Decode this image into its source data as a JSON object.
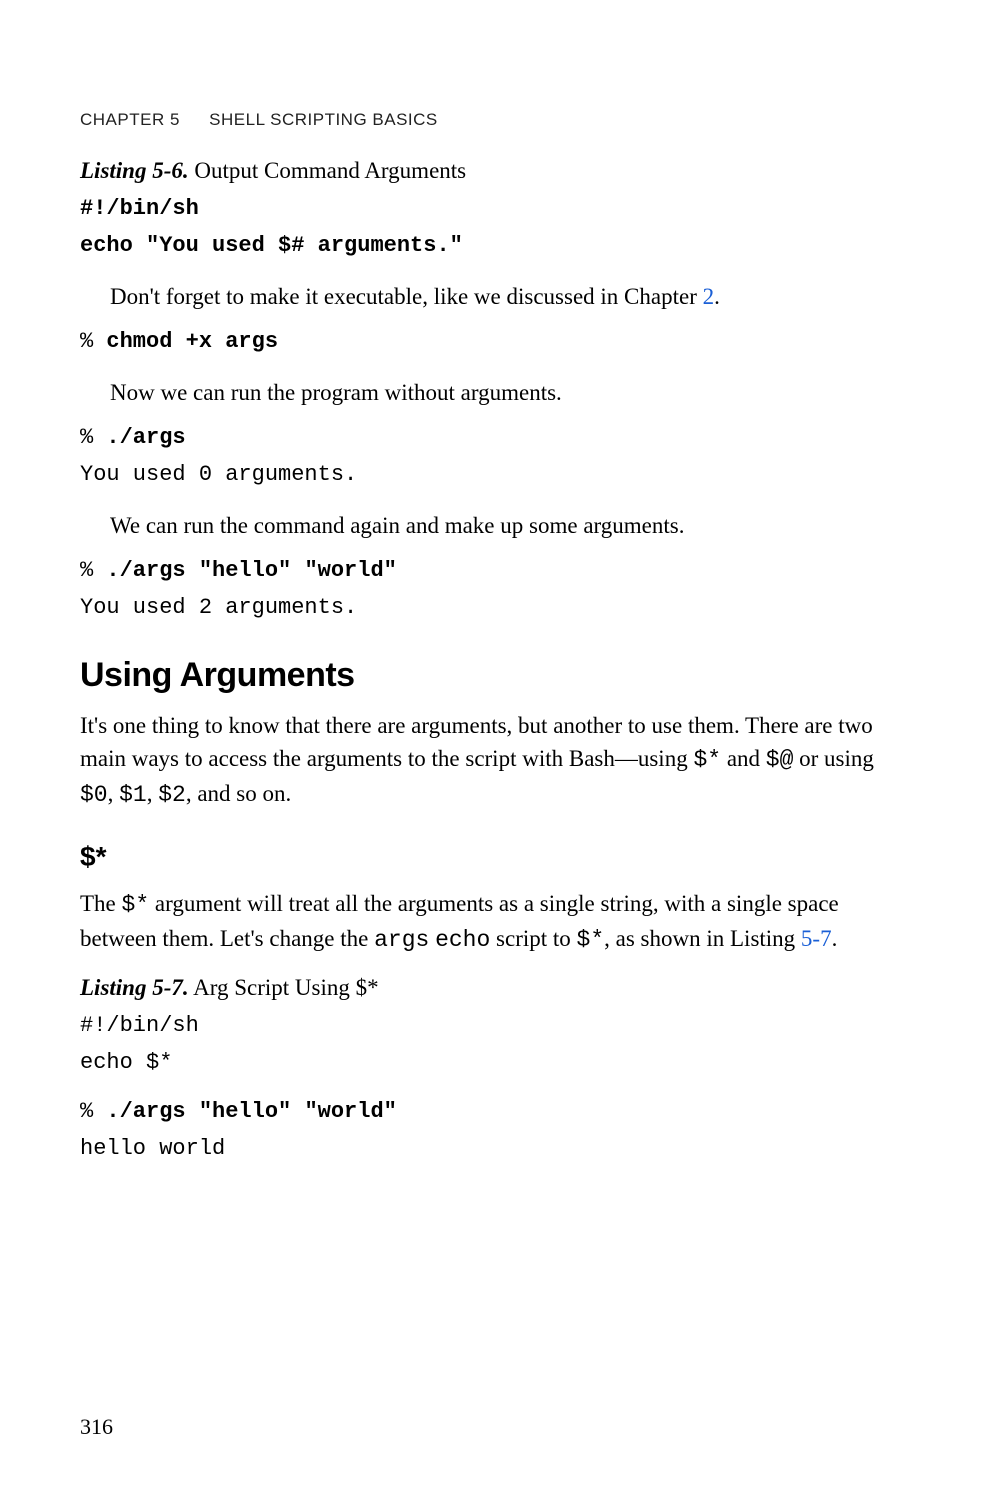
{
  "header": {
    "chapter": "CHAPTER 5",
    "title": "SHELL SCRIPTING BASICS"
  },
  "listing56": {
    "label": "Listing 5-6.",
    "title": " Output Command Arguments",
    "code_l1": "#!/bin/sh",
    "code_l2": "echo \"You used $# arguments.\""
  },
  "para1_a": "Don't forget to make it executable, like we discussed in Chapter ",
  "para1_link": "2",
  "para1_b": ".",
  "cmd1_prompt": "% ",
  "cmd1": "chmod +x args",
  "para2": "Now we can run the program without arguments.",
  "cmd2_prompt": "% ",
  "cmd2": "./args",
  "out2": "You used 0 arguments.",
  "para3": "We can run the command again and make up some arguments.",
  "cmd3_prompt": "% ",
  "cmd3": "./args \"hello\" \"world\"",
  "out3": "You used 2 arguments.",
  "h2": "Using Arguments",
  "para4_a": "It's one thing to know that there are arguments, but another to use them. There are two main ways to access the arguments to the script with Bash—using ",
  "para4_c1": "$*",
  "para4_b": " and ",
  "para4_c2": "$@",
  "para4_c": " or using ",
  "para4_c3": "$0",
  "para4_d": ", ",
  "para4_c4": "$1",
  "para4_e": ", ",
  "para4_c5": "$2",
  "para4_f": ", and so on.",
  "h3": "$*",
  "para5_a": "The ",
  "para5_c1": "$*",
  "para5_b": " argument will treat all the arguments as a single string, with a single space between them. Let's change the ",
  "para5_c2": "args",
  "para5_c": " ",
  "para5_c3": "echo",
  "para5_d": " script to ",
  "para5_c4": "$*",
  "para5_e": ", as shown in Listing ",
  "para5_link": "5-7",
  "para5_f": ".",
  "listing57": {
    "label": "Listing 5-7.",
    "title": " Arg Script Using $*",
    "code_l1": "#!/bin/sh",
    "code_l2": "echo $*"
  },
  "cmd4_prompt": "% ",
  "cmd4": "./args \"hello\" \"world\"",
  "out4": "hello world",
  "page_number": "316"
}
